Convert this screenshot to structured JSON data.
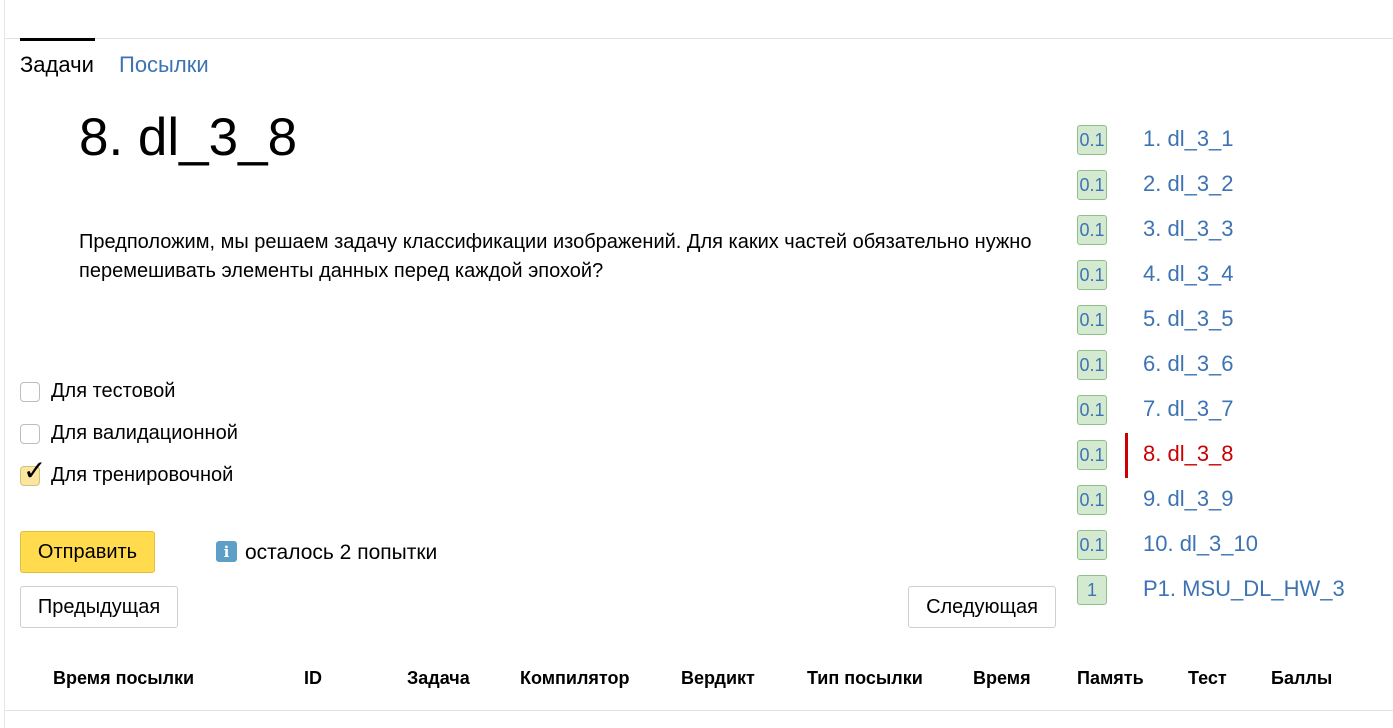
{
  "tabs": {
    "active": "Задачи",
    "submissions": "Посылки"
  },
  "problem": {
    "title": "8. dl_3_8",
    "statement": "Предположим, мы решаем задачу классификации изображений. Для каких частей обязательно нужно перемешивать элементы данных перед каждой эпохой?"
  },
  "options": [
    {
      "label": "Для тестовой",
      "checked": false
    },
    {
      "label": "Для валидационной",
      "checked": false
    },
    {
      "label": "Для тренировочной",
      "checked": true
    }
  ],
  "actions": {
    "submit": "Отправить",
    "attempts_left": "осталось 2 попытки",
    "info_glyph": "i",
    "prev": "Предыдущая",
    "next": "Следующая"
  },
  "problems_list": [
    {
      "score": "0.1",
      "name": "1. dl_3_1",
      "current": false
    },
    {
      "score": "0.1",
      "name": "2. dl_3_2",
      "current": false
    },
    {
      "score": "0.1",
      "name": "3. dl_3_3",
      "current": false
    },
    {
      "score": "0.1",
      "name": "4. dl_3_4",
      "current": false
    },
    {
      "score": "0.1",
      "name": "5. dl_3_5",
      "current": false
    },
    {
      "score": "0.1",
      "name": "6. dl_3_6",
      "current": false
    },
    {
      "score": "0.1",
      "name": "7. dl_3_7",
      "current": false
    },
    {
      "score": "0.1",
      "name": "8. dl_3_8",
      "current": true
    },
    {
      "score": "0.1",
      "name": "9. dl_3_9",
      "current": false
    },
    {
      "score": "0.1",
      "name": "10. dl_3_10",
      "current": false
    },
    {
      "score": "1",
      "name": "P1. MSU_DL_HW_3",
      "current": false
    }
  ],
  "table": {
    "headers": [
      "Время посылки",
      "ID",
      "Задача",
      "Компилятор",
      "Вердикт",
      "Тип посылки",
      "Время",
      "Память",
      "Тест",
      "Баллы"
    ]
  },
  "colors": {
    "link": "#3d73b3",
    "current": "#cc0000",
    "submit_button": "#ffdb4d",
    "score_badge": "#d3ead1"
  }
}
